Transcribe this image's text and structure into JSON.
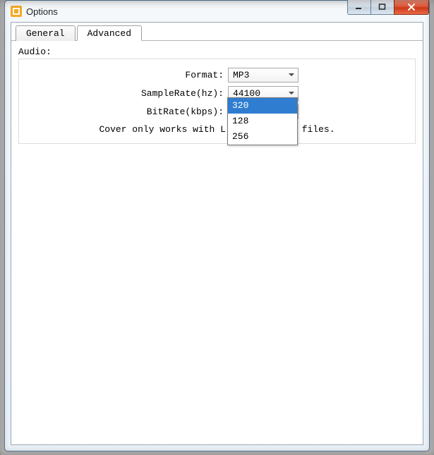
{
  "window": {
    "title": "Options"
  },
  "tabs": {
    "general": "General",
    "advanced": "Advanced"
  },
  "audio": {
    "section_label": "Audio:",
    "format_label": "Format:",
    "format_value": "MP3",
    "samplerate_label": "SampleRate(hz):",
    "samplerate_value": "44100",
    "bitrate_label": "BitRate(kbps):",
    "bitrate_value": "320",
    "bitrate_options": [
      "320",
      "128",
      "256"
    ],
    "note_left": "Cover only works with L",
    "note_right": " files."
  }
}
